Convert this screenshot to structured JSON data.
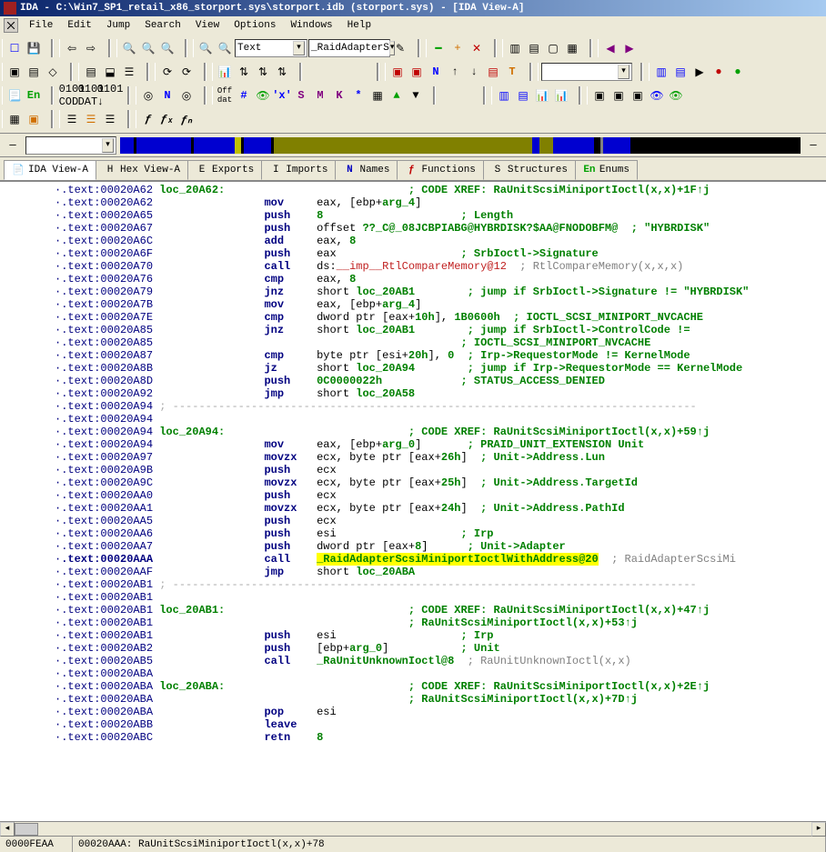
{
  "window": {
    "title": "IDA - C:\\Win7_SP1_retail_x86_storport.sys\\storport.idb (storport.sys) - [IDA View-A]"
  },
  "menu": [
    "File",
    "Edit",
    "Jump",
    "Search",
    "View",
    "Options",
    "Windows",
    "Help"
  ],
  "toolbar": {
    "search_mode": "Text",
    "symbol_filter": "_RaidAdapterS"
  },
  "tabs": {
    "items": [
      {
        "name": "ida-view-a",
        "label": "IDA View-A",
        "icon": "📄",
        "active": true
      },
      {
        "name": "hex-view-a",
        "label": "Hex View-A",
        "icon": "H"
      },
      {
        "name": "exports",
        "label": "Exports",
        "icon": "E"
      },
      {
        "name": "imports",
        "label": "Imports",
        "icon": "I"
      },
      {
        "name": "names",
        "label": "Names",
        "icon": "N"
      },
      {
        "name": "functions",
        "label": "Functions",
        "icon": "ƒ"
      },
      {
        "name": "structures",
        "label": "Structures",
        "icon": "S"
      },
      {
        "name": "enums",
        "label": "Enums",
        "icon": "En"
      }
    ]
  },
  "nav": {
    "address": ""
  },
  "navstrip": [
    {
      "color": "#0000d0",
      "pct": 2
    },
    {
      "color": "#000000",
      "pct": 0.4
    },
    {
      "color": "#0000d0",
      "pct": 8
    },
    {
      "color": "#000000",
      "pct": 0.4
    },
    {
      "color": "#0000d0",
      "pct": 6
    },
    {
      "color": "#c0c000",
      "pct": 1
    },
    {
      "color": "#000000",
      "pct": 0.4
    },
    {
      "color": "#0000d0",
      "pct": 4
    },
    {
      "color": "#000000",
      "pct": 0.4
    },
    {
      "color": "#808000",
      "pct": 38
    },
    {
      "color": "#0000d0",
      "pct": 1
    },
    {
      "color": "#808000",
      "pct": 2
    },
    {
      "color": "#0000d0",
      "pct": 6
    },
    {
      "color": "#000000",
      "pct": 1
    },
    {
      "color": "#808080",
      "pct": 0.4
    },
    {
      "color": "#0000d0",
      "pct": 4
    },
    {
      "color": "#000000",
      "pct": 25
    }
  ],
  "icons": {
    "en": "En",
    "n": "N",
    "h": "H",
    "s": "S",
    "m": "M",
    "k": "K",
    "xs": "'x'",
    "star": "*",
    "plus": "+",
    "minus": "−",
    "cross": "×"
  },
  "highlight": "_RaidAdapterScsiMiniportIoctlWithAddress@20",
  "status": {
    "offset": "0000FEAA",
    "location": "00020AAA: RaUnitScsiMiniportIoctl(x,x)+78"
  },
  "disasm": {
    "lines": [
      {
        "addr": ".text:00020A62",
        "label": "loc_20A62:",
        "xref": "; CODE XREF: RaUnitScsiMiniportIoctl(x,x)+1F↑j"
      },
      {
        "addr": ".text:00020A62",
        "op": "mov",
        "args": "eax, [ebp+",
        "sym": "arg_4",
        "post": "]"
      },
      {
        "addr": ".text:00020A65",
        "op": "push",
        "args": "",
        "num": "8",
        "c": "; Length"
      },
      {
        "addr": ".text:00020A67",
        "op": "push",
        "args": "offset ",
        "sym": "??_C@_08JCBPIABG@HYBRDISK?$AA@FNODOBFM@",
        "c": " ; \"HYBRDISK\""
      },
      {
        "addr": ".text:00020A6C",
        "op": "add",
        "args": "eax, ",
        "num": "8"
      },
      {
        "addr": ".text:00020A6F",
        "op": "push",
        "args": "eax",
        "c": "; SrbIoctl->Signature"
      },
      {
        "addr": ".text:00020A70",
        "op": "call",
        "args": "ds:",
        "imp": "__imp__RtlCompareMemory@12",
        "gc": " ; RtlCompareMemory(x,x,x)"
      },
      {
        "addr": ".text:00020A76",
        "op": "cmp",
        "args": "eax, ",
        "num": "8"
      },
      {
        "addr": ".text:00020A79",
        "op": "jnz",
        "args": "short ",
        "ref": "loc_20AB1",
        "c": " ; jump if SrbIoctl->Signature != \"HYBRDISK\""
      },
      {
        "addr": ".text:00020A7B",
        "op": "mov",
        "args": "eax, [ebp+",
        "sym": "arg_4",
        "post": "]"
      },
      {
        "addr": ".text:00020A7E",
        "op": "cmp",
        "args": "dword ptr [eax+",
        "num": "10h",
        "post": "], ",
        "num2": "1B0600h",
        "c": " ; IOCTL_SCSI_MINIPORT_NVCACHE"
      },
      {
        "addr": ".text:00020A85",
        "op": "jnz",
        "args": "short ",
        "ref": "loc_20AB1",
        "c": " ; jump if SrbIoctl->ControlCode !="
      },
      {
        "addr": ".text:00020A85",
        "op": "",
        "args": "",
        "c": "; IOCTL_SCSI_MINIPORT_NVCACHE"
      },
      {
        "addr": ".text:00020A87",
        "op": "cmp",
        "args": "byte ptr [esi+",
        "num": "20h",
        "post": "], ",
        "num2": "0",
        "c": " ; Irp->RequestorMode != KernelMode"
      },
      {
        "addr": ".text:00020A8B",
        "op": "jz",
        "args": "short ",
        "ref": "loc_20A94",
        "c": " ; jump if Irp->RequestorMode == KernelMode"
      },
      {
        "addr": ".text:00020A8D",
        "op": "push",
        "args": "",
        "num": "0C0000022h",
        "c": "; STATUS_ACCESS_DENIED"
      },
      {
        "addr": ".text:00020A92",
        "op": "jmp",
        "args": "short ",
        "ref": "loc_20A58"
      },
      {
        "addr": ".text:00020A94",
        "dash": true
      },
      {
        "addr": ".text:00020A94"
      },
      {
        "addr": ".text:00020A94",
        "label": "loc_20A94:",
        "xref": "; CODE XREF: RaUnitScsiMiniportIoctl(x,x)+59↑j"
      },
      {
        "addr": ".text:00020A94",
        "op": "mov",
        "args": "eax, [ebp+",
        "sym": "arg_0",
        "post": "]",
        "c": " ; PRAID_UNIT_EXTENSION Unit"
      },
      {
        "addr": ".text:00020A97",
        "op": "movzx",
        "args": "ecx, byte ptr [eax+",
        "num": "26h",
        "post": "]",
        "c": " ; Unit->Address.Lun"
      },
      {
        "addr": ".text:00020A9B",
        "op": "push",
        "args": "ecx"
      },
      {
        "addr": ".text:00020A9C",
        "op": "movzx",
        "args": "ecx, byte ptr [eax+",
        "num": "25h",
        "post": "]",
        "c": " ; Unit->Address.TargetId"
      },
      {
        "addr": ".text:00020AA0",
        "op": "push",
        "args": "ecx"
      },
      {
        "addr": ".text:00020AA1",
        "op": "movzx",
        "args": "ecx, byte ptr [eax+",
        "num": "24h",
        "post": "]",
        "c": " ; Unit->Address.PathId"
      },
      {
        "addr": ".text:00020AA5",
        "op": "push",
        "args": "ecx"
      },
      {
        "addr": ".text:00020AA6",
        "op": "push",
        "args": "esi",
        "c": "; Irp"
      },
      {
        "addr": ".text:00020AA7",
        "op": "push",
        "args": "dword ptr [eax+",
        "num": "8",
        "post": "]",
        "c": " ; Unit->Adapter"
      },
      {
        "addr": ".text:00020AAA",
        "op": "call",
        "args": "",
        "hl": true,
        "ref": "_RaidAdapterScsiMiniportIoctlWithAddress@20",
        "gc": " ; RaidAdapterScsiMi",
        "addrStyle": "blue"
      },
      {
        "addr": ".text:00020AAF",
        "op": "jmp",
        "args": "short ",
        "ref": "loc_20ABA"
      },
      {
        "addr": ".text:00020AB1",
        "dash": true
      },
      {
        "addr": ".text:00020AB1"
      },
      {
        "addr": ".text:00020AB1",
        "label": "loc_20AB1:",
        "xref": "; CODE XREF: RaUnitScsiMiniportIoctl(x,x)+47↑j",
        "xref2": "; RaUnitScsiMiniportIoctl(x,x)+53↑j"
      },
      {
        "addr": ".text:00020AB1",
        "op": "push",
        "args": "esi",
        "c": "; Irp"
      },
      {
        "addr": ".text:00020AB2",
        "op": "push",
        "args": "[ebp+",
        "sym": "arg_0",
        "post": "]",
        "c": "; Unit"
      },
      {
        "addr": ".text:00020AB5",
        "op": "call",
        "args": "",
        "ref": "_RaUnitUnknownIoctl@8",
        "gc": " ; RaUnitUnknownIoctl(x,x)"
      },
      {
        "addr": ".text:00020ABA"
      },
      {
        "addr": ".text:00020ABA",
        "label": "loc_20ABA:",
        "xref": "; CODE XREF: RaUnitScsiMiniportIoctl(x,x)+2E↑j",
        "xref2": "; RaUnitScsiMiniportIoctl(x,x)+7D↑j"
      },
      {
        "addr": ".text:00020ABA",
        "op": "pop",
        "args": "esi"
      },
      {
        "addr": ".text:00020ABB",
        "op": "leave"
      },
      {
        "addr": ".text:00020ABC",
        "op": "retn",
        "args": "",
        "num": "8"
      }
    ]
  }
}
